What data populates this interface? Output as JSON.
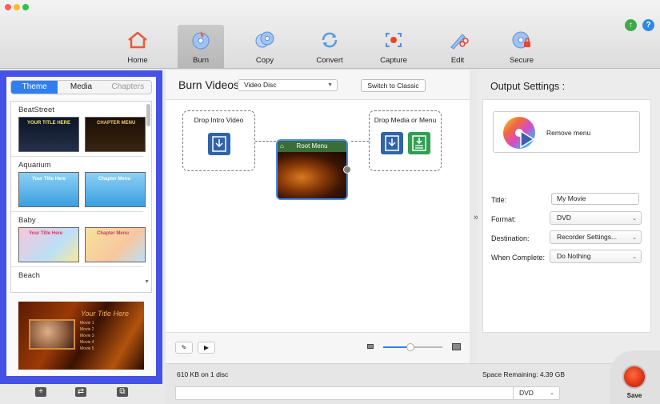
{
  "toolbar": {
    "items": [
      {
        "label": "Home",
        "icon": "home-icon"
      },
      {
        "label": "Burn",
        "icon": "burn-disc-icon",
        "active": true
      },
      {
        "label": "Copy",
        "icon": "copy-disc-icon"
      },
      {
        "label": "Convert",
        "icon": "convert-icon"
      },
      {
        "label": "Capture",
        "icon": "capture-icon"
      },
      {
        "label": "Edit",
        "icon": "edit-icon"
      },
      {
        "label": "Secure",
        "icon": "secure-disc-icon"
      }
    ],
    "accent_active": "#bdbdbd"
  },
  "left_panel": {
    "tabs": [
      "Theme",
      "Media",
      "Chapters"
    ],
    "active_tab": "Theme",
    "themes": [
      {
        "name": "BeatStreet",
        "thumb1_text": "YOUR TITLE HERE",
        "thumb2_text": "CHAPTER MENU"
      },
      {
        "name": "Aquarium",
        "thumb1_text": "Your Title Here",
        "thumb2_text": "Chapter Menu"
      },
      {
        "name": "Baby",
        "thumb1_text": "Your Title Here",
        "thumb2_text": "Chapter Menu"
      },
      {
        "name": "Beach"
      }
    ],
    "preview": {
      "title": "Your Title Here",
      "items": [
        "Movie 1",
        "Movie 2",
        "Movie 3",
        "Movie 4",
        "Movie 5"
      ]
    },
    "frame_color": "#4651e6"
  },
  "center": {
    "title": "Burn Videos",
    "disc_type": "Video Disc",
    "switch_label": "Switch to Classic",
    "drop_intro_label": "Drop Intro Video",
    "root_menu_label": "Root Menu",
    "drop_media_label": "Drop Media or Menu"
  },
  "output": {
    "title": "Output Settings :",
    "remove_menu_label": "Remove menu",
    "fields": {
      "title_label": "Title:",
      "title_value": "My Movie",
      "format_label": "Format:",
      "format_value": "DVD",
      "destination_label": "Destination:",
      "destination_value": "Recorder Settings...",
      "when_complete_label": "When Complete:",
      "when_complete_value": "Do Nothing"
    }
  },
  "status": {
    "usage": "610 KB on 1 disc",
    "space_remaining": "Space Remaining: 4.39 GB",
    "disc_format": "DVD",
    "save_label": "Save"
  }
}
